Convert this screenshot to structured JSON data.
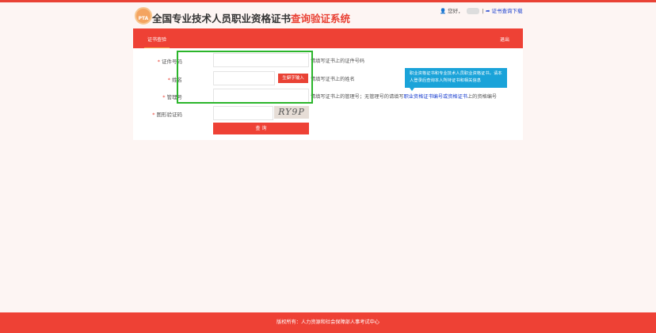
{
  "header": {
    "logo_text": "PTA",
    "title_main": "全国专业技术人员职业资格证书",
    "title_accent": "查询验证系统",
    "greeting": "您好，",
    "download_link": "证书查询下载"
  },
  "nav": {
    "tab": "证书查验",
    "logout": "退出"
  },
  "form": {
    "fields": [
      {
        "label": "证件号码",
        "value": "",
        "hint": "请填写证书上的证件号码"
      },
      {
        "label": "姓名",
        "value": "",
        "hint": "请填写证书上的姓名",
        "extra_button": "生僻字输入"
      },
      {
        "label": "管理号",
        "value": "",
        "hint_prefix": "请填写证书上的管理号；无管理号的请填写",
        "hint_link": "职业资格证书编号或资格证书",
        "hint_suffix": "上的资格编号"
      },
      {
        "label": "图形验证码",
        "value": "",
        "captcha": "RY9P"
      }
    ],
    "required_mark": "*",
    "submit": "查 询"
  },
  "tooltip": {
    "text": "职业资格证书和专业技术人员职业资格证书，请本人登录后查询本人所持证书和相关信息"
  },
  "footer": {
    "text": "版权所有：人力资源和社会保障部人事考试中心"
  },
  "colors": {
    "brand": "#ee4135",
    "highlight": "#2bb52b",
    "tooltip": "#1aa3d9",
    "link": "#1a3fcf"
  }
}
